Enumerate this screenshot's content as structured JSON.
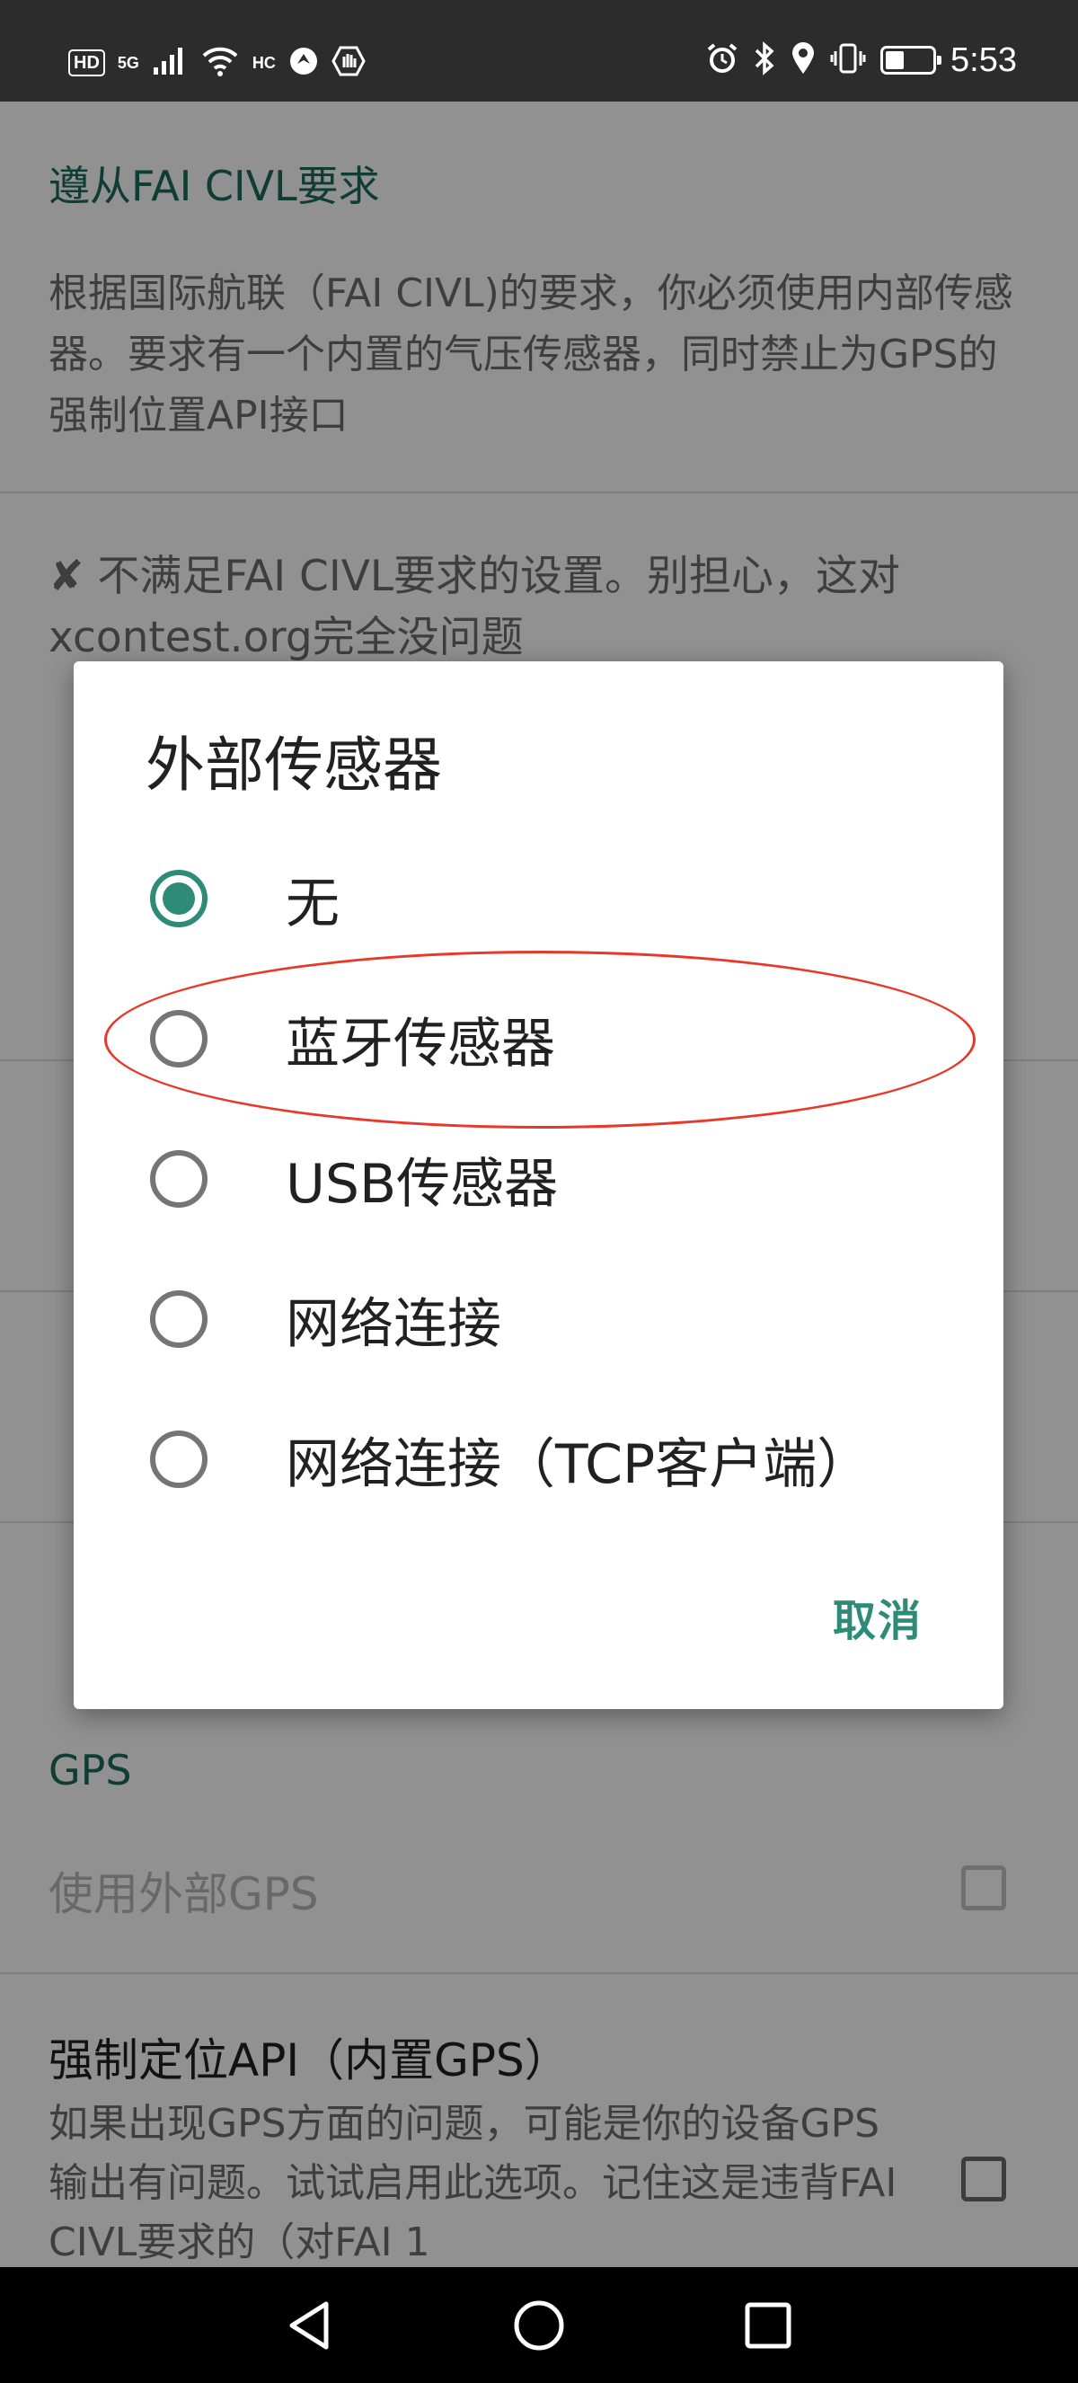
{
  "status_bar": {
    "hd_badge": "HD",
    "network_type": "5G",
    "wifi_badge": "HC",
    "time": "5:53",
    "battery_level": 0.4
  },
  "settings": {
    "fai_section_title": "遵从FAI CIVL要求",
    "fai_description": "根据国际航联（FAI CIVL)的要求，你必须使用内部传感器。要求有一个内置的气压传感器，同时禁止为GPS的强制位置API接口",
    "fai_status_mark": "✘",
    "fai_status": "不满足FAI CIVL要求的设置。别担心，这对xcontest.org完全没问题",
    "gps_section_title": "GPS",
    "use_external_gps": "使用外部GPS",
    "force_location_api_title": "强制定位API（内置GPS）",
    "force_location_api_summary": "如果出现GPS方面的问题，可能是你的设备GPS输出有问题。试试启用此选项。记住这是违背FAI CIVL要求的（对FAI 1"
  },
  "dialog": {
    "title": "外部传感器",
    "options": [
      {
        "label": "无",
        "selected": true
      },
      {
        "label": "蓝牙传感器",
        "selected": false
      },
      {
        "label": "USB传感器",
        "selected": false
      },
      {
        "label": "网络连接",
        "selected": false
      },
      {
        "label": "网络连接（TCP客户端）",
        "selected": false
      }
    ],
    "cancel_label": "取消"
  },
  "colors": {
    "accent": "#2e8b78",
    "annotation": "#e8382a"
  }
}
